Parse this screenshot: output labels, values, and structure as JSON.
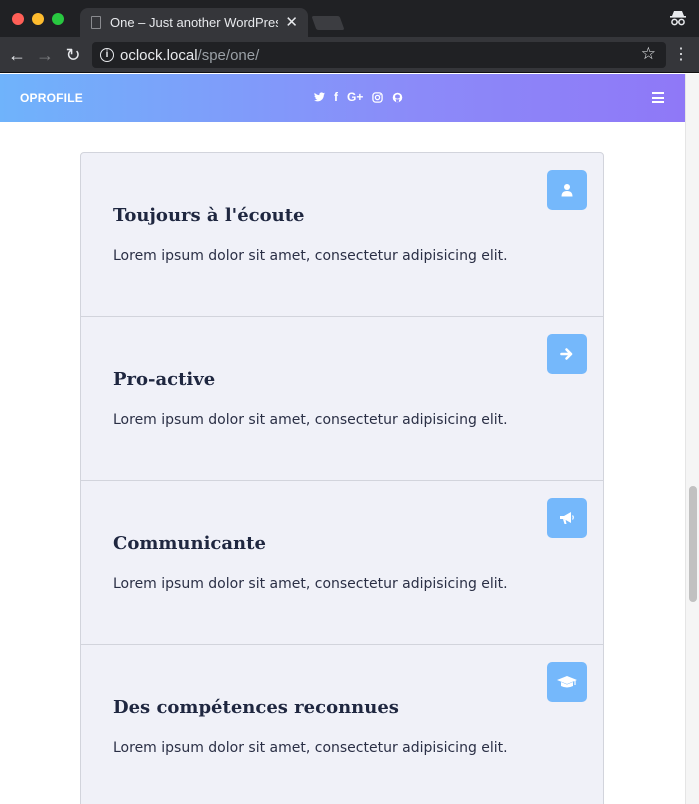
{
  "browser": {
    "tab_title": "One – Just another WordPress site",
    "tab_close": "✕",
    "url_host": "oclock.local",
    "url_path": "/spe/one/",
    "star_glyph": "☆",
    "menu_glyph": "⋮",
    "back_glyph": "←",
    "forward_glyph": "→",
    "reload_glyph": "↻",
    "info_glyph": "i"
  },
  "header": {
    "logo": "OPROFILE",
    "socials": [
      {
        "icon": "twitter-icon",
        "glyph": ""
      },
      {
        "icon": "facebook-icon",
        "glyph": "f"
      },
      {
        "icon": "google-plus-icon",
        "glyph": "G+"
      },
      {
        "icon": "instagram-icon",
        "glyph": ""
      },
      {
        "icon": "github-icon",
        "glyph": ""
      }
    ],
    "menu_icon": "hamburger-menu-icon"
  },
  "features": [
    {
      "icon": "user-icon",
      "title": "Toujours à l'écoute",
      "text": "Lorem ipsum dolor sit amet, consectetur adipisicing elit."
    },
    {
      "icon": "arrow-right-icon",
      "title": "Pro-active",
      "text": "Lorem ipsum dolor sit amet, consectetur adipisicing elit."
    },
    {
      "icon": "megaphone-icon",
      "title": "Communicante",
      "text": "Lorem ipsum dolor sit amet, consectetur adipisicing elit."
    },
    {
      "icon": "graduation-cap-icon",
      "title": "Des compétences reconnues",
      "text": "Lorem ipsum dolor sit amet, consectetur adipisicing elit."
    }
  ],
  "colors": {
    "header_gradient_start": "#6fb3fb",
    "header_gradient_end": "#8f78f7",
    "icon_bg": "#75b8fb",
    "card_bg": "#f0f1f8",
    "title_color": "#1f2740"
  }
}
